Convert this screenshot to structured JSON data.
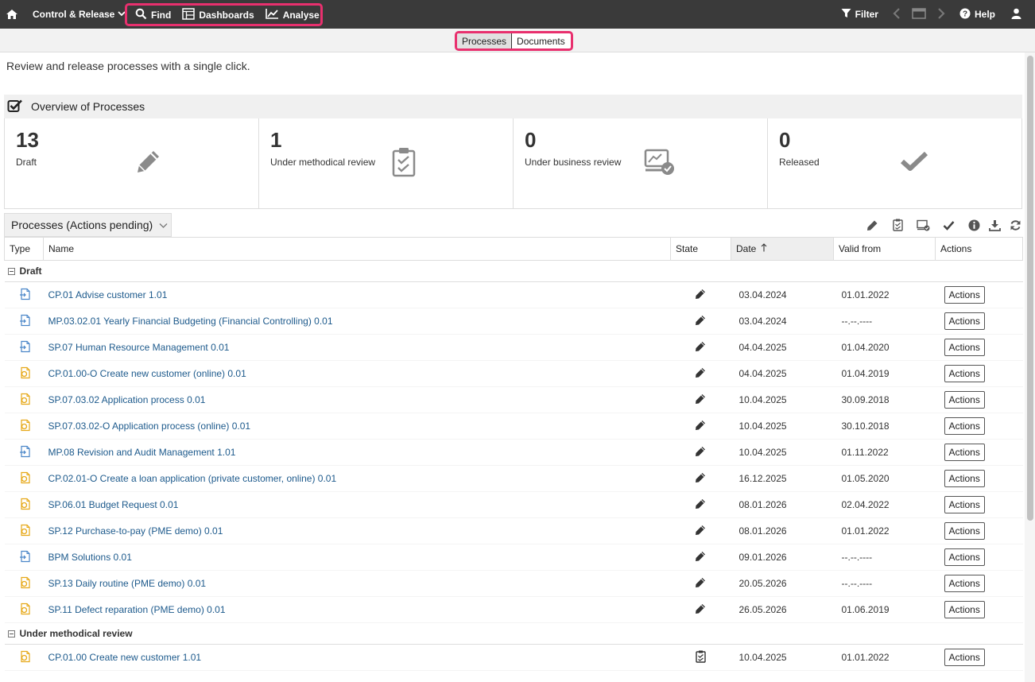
{
  "topbar": {
    "menu_label": "Control & Release",
    "nav": [
      {
        "label": "Find",
        "icon": "search-icon"
      },
      {
        "label": "Dashboards",
        "icon": "dashboard-icon"
      },
      {
        "label": "Analyse",
        "icon": "chart-line-icon"
      }
    ],
    "filter_label": "Filter",
    "help_label": "Help"
  },
  "tabs": [
    {
      "label": "Processes",
      "active": true
    },
    {
      "label": "Documents",
      "active": false
    }
  ],
  "intro": "Review and release processes with a single click.",
  "overview": {
    "title": "Overview of Processes",
    "kpis": [
      {
        "count": "13",
        "label": "Draft",
        "icon": "pencil-icon"
      },
      {
        "count": "1",
        "label": "Under methodical review",
        "icon": "clipboard-check-icon"
      },
      {
        "count": "0",
        "label": "Under business review",
        "icon": "monitor-check-icon"
      },
      {
        "count": "0",
        "label": "Released",
        "icon": "checkmark-icon"
      }
    ]
  },
  "list": {
    "view_label": "Processes (Actions pending)",
    "columns": {
      "type": "Type",
      "name": "Name",
      "state": "State",
      "date": "Date",
      "valid_from": "Valid from",
      "actions": "Actions"
    },
    "action_label": "Actions",
    "groups": [
      {
        "title": "Draft",
        "rows": [
          {
            "type": "process",
            "name": "CP.01 Advise customer 1.01",
            "state": "pencil-icon",
            "date": "03.04.2024",
            "valid_from": "01.01.2022"
          },
          {
            "type": "process",
            "name": "MP.03.02.01 Yearly Financial Budgeting (Financial Controlling) 0.01",
            "state": "pencil-icon",
            "date": "03.04.2024",
            "valid_from": "--.--.----"
          },
          {
            "type": "process",
            "name": "SP.07 Human Resource Management 0.01",
            "state": "pencil-icon",
            "date": "04.04.2025",
            "valid_from": "01.04.2020"
          },
          {
            "type": "online",
            "name": "CP.01.00-O Create new customer (online) 0.01",
            "state": "pencil-icon",
            "date": "04.04.2025",
            "valid_from": "01.04.2019"
          },
          {
            "type": "online",
            "name": "SP.07.03.02 Application process 0.01",
            "state": "pencil-icon",
            "date": "10.04.2025",
            "valid_from": "30.09.2018"
          },
          {
            "type": "online",
            "name": "SP.07.03.02-O Application process (online) 0.01",
            "state": "pencil-icon",
            "date": "10.04.2025",
            "valid_from": "30.10.2018"
          },
          {
            "type": "process",
            "name": "MP.08 Revision and Audit Management 1.01",
            "state": "pencil-icon",
            "date": "10.04.2025",
            "valid_from": "01.11.2022"
          },
          {
            "type": "online",
            "name": "CP.02.01-O Create a loan application (private customer, online) 0.01",
            "state": "pencil-icon",
            "date": "16.12.2025",
            "valid_from": "01.05.2020"
          },
          {
            "type": "online",
            "name": "SP.06.01 Budget Request 0.01",
            "state": "pencil-icon",
            "date": "08.01.2026",
            "valid_from": "02.04.2022"
          },
          {
            "type": "online",
            "name": "SP.12 Purchase-to-pay (PME demo) 0.01",
            "state": "pencil-icon",
            "date": "08.01.2026",
            "valid_from": "01.01.2022"
          },
          {
            "type": "process",
            "name": "BPM Solutions 0.01",
            "state": "pencil-icon",
            "date": "09.01.2026",
            "valid_from": "--.--.----"
          },
          {
            "type": "online",
            "name": "SP.13 Daily routine (PME demo) 0.01",
            "state": "pencil-icon",
            "date": "20.05.2026",
            "valid_from": "--.--.----"
          },
          {
            "type": "online",
            "name": "SP.11 Defect reparation (PME demo) 0.01",
            "state": "pencil-icon",
            "date": "26.05.2026",
            "valid_from": "01.06.2019"
          }
        ]
      },
      {
        "title": "Under methodical review",
        "rows": [
          {
            "type": "online",
            "name": "CP.01.00 Create new customer 1.01",
            "state": "clipboard-check-icon",
            "date": "10.04.2025",
            "valid_from": "01.01.2022"
          }
        ]
      }
    ]
  },
  "colors": {
    "topbar": "#3a3a3a",
    "highlight": "#e8306e",
    "link": "#1d5a8c"
  }
}
